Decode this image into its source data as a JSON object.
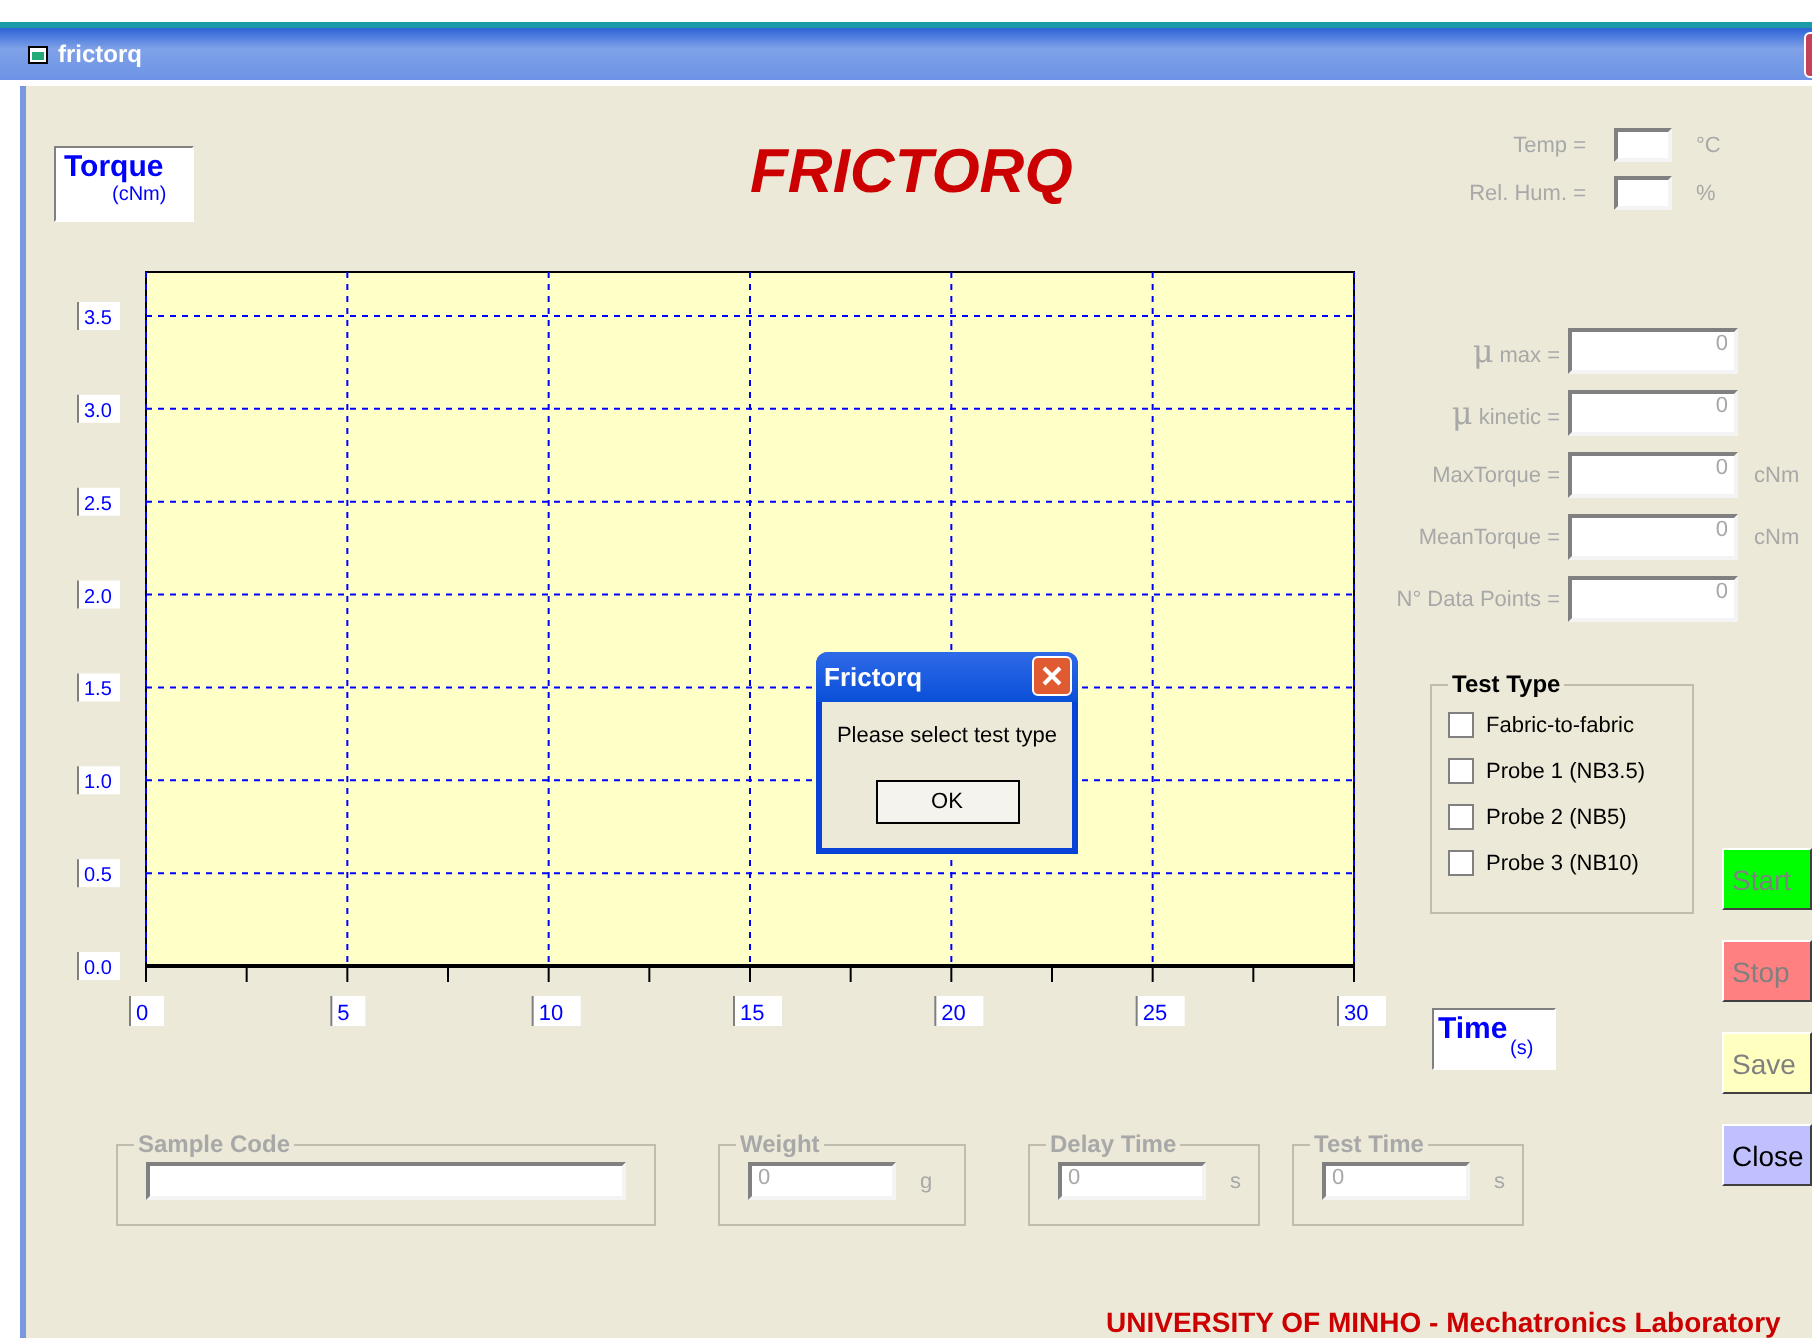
{
  "window": {
    "title": "frictorq"
  },
  "app_title": "FRICTORQ",
  "torque_label": {
    "title": "Torque",
    "unit": "(cNm)"
  },
  "ambient": [
    {
      "label": "Temp =",
      "unit": "°C",
      "disabled": true
    },
    {
      "label": "Rel. Hum. =",
      "unit": "%",
      "disabled": true
    }
  ],
  "chart_data": {
    "type": "line",
    "grid": true,
    "xlim": [
      0,
      30
    ],
    "ylim": [
      0,
      3.5
    ],
    "xticks": [
      {
        "value": 0,
        "label": "0"
      },
      {
        "value": 5,
        "label": "5"
      },
      {
        "value": 10,
        "label": "10"
      },
      {
        "value": 15,
        "label": "15"
      },
      {
        "value": 20,
        "label": "20"
      },
      {
        "value": 25,
        "label": "25"
      },
      {
        "value": 30,
        "label": "30"
      }
    ],
    "yticks": [
      {
        "value": 0,
        "label": "0.0"
      },
      {
        "value": 0.5,
        "label": "0.5"
      },
      {
        "value": 1,
        "label": "1.0"
      },
      {
        "value": 1.5,
        "label": "1.5"
      },
      {
        "value": 2,
        "label": "2.0"
      },
      {
        "value": 2.5,
        "label": "2.5"
      },
      {
        "value": 3,
        "label": "3.0"
      },
      {
        "value": 3.5,
        "label": "3.5"
      }
    ]
  },
  "time_label": {
    "title": "Time",
    "unit": "(s)"
  },
  "results": [
    {
      "symbol": "μ",
      "label": "max =",
      "value": "0",
      "disabled": true
    },
    {
      "symbol": "μ",
      "label": "kinetic =",
      "value": "0",
      "disabled": true
    },
    {
      "label": "MaxTorque =",
      "value": "0",
      "unit": "cNm",
      "disabled": true
    },
    {
      "label": "MeanTorque =",
      "value": "0",
      "unit": "cNm",
      "disabled": true
    },
    {
      "label": "N° Data Points =",
      "value": "0",
      "disabled": true
    }
  ],
  "test_type": {
    "title": "Test Type",
    "options": [
      {
        "label": "Fabric-to-fabric",
        "checked": false
      },
      {
        "label": "Probe 1 (NB3.5)",
        "checked": false
      },
      {
        "label": "Probe 2 (NB5)",
        "checked": false
      },
      {
        "label": "Probe 3 (NB10)",
        "checked": false
      }
    ]
  },
  "buttons": [
    {
      "label": "Start",
      "kind": "start",
      "disabled": true
    },
    {
      "label": "Stop",
      "kind": "stop",
      "disabled": true
    },
    {
      "label": "Save",
      "kind": "save",
      "disabled": true
    },
    {
      "label": "Close",
      "kind": "close",
      "disabled": false
    }
  ],
  "parameters": [
    {
      "title": "Sample Code",
      "disabled": true
    },
    {
      "title": "Weight",
      "value": "0",
      "unit": "g",
      "disabled": true
    },
    {
      "title": "Delay Time",
      "value": "0",
      "unit": "s",
      "disabled": true
    },
    {
      "title": "Test Time",
      "value": "0",
      "unit": "s",
      "disabled": true
    }
  ],
  "footer": "UNIVERSITY OF MINHO  - Mechatronics Laboratory",
  "dialog": {
    "title": "Frictorq",
    "message": "Please select test type",
    "button": "OK"
  }
}
